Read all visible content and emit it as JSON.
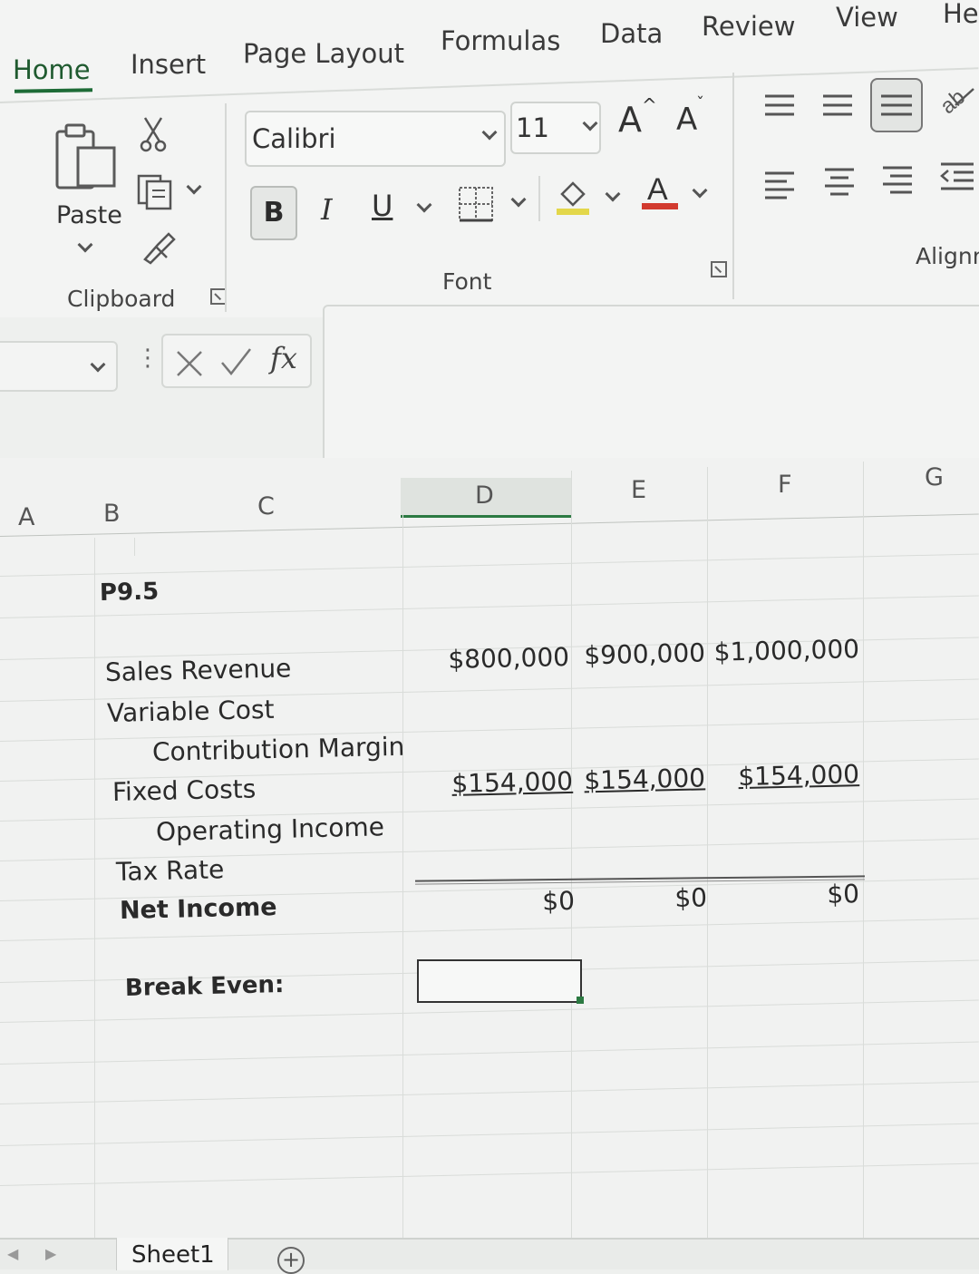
{
  "ribbon": {
    "tabs": [
      "Home",
      "Insert",
      "Page Layout",
      "Formulas",
      "Data",
      "Review",
      "View",
      "He"
    ],
    "active_tab": "Home",
    "clipboard": {
      "paste_label": "Paste",
      "group_label": "Clipboard"
    },
    "font": {
      "name": "Calibri",
      "size": "11",
      "bold": "B",
      "italic": "I",
      "underline": "U",
      "group_label": "Font",
      "grow": "A",
      "shrink": "A"
    },
    "alignment": {
      "group_label": "Alignn"
    }
  },
  "formula_bar": {
    "fx": "fx",
    "content": ""
  },
  "grid": {
    "columns": [
      "A",
      "B",
      "C",
      "D",
      "E",
      "F",
      "G"
    ],
    "title": "P9.5",
    "labels": {
      "sales_revenue": "Sales Revenue",
      "variable_cost": "Variable Cost",
      "contribution_margin": "Contribution Margin",
      "fixed_costs": "Fixed Costs",
      "operating_income": "Operating Income",
      "tax_rate": "Tax Rate",
      "net_income": "Net Income",
      "break_even": "Break Even:"
    },
    "sales_revenue": [
      "$800,000",
      "$900,000",
      "$1,000,000"
    ],
    "fixed_costs": [
      "$154,000",
      "$154,000",
      "$154,000"
    ],
    "net_income": [
      "$0",
      "$0",
      "$0"
    ]
  },
  "sheets": {
    "tabs": [
      "Sheet1"
    ],
    "add": "+"
  },
  "colors": {
    "accent": "#1d6b36",
    "selection": "#2c7a42"
  }
}
